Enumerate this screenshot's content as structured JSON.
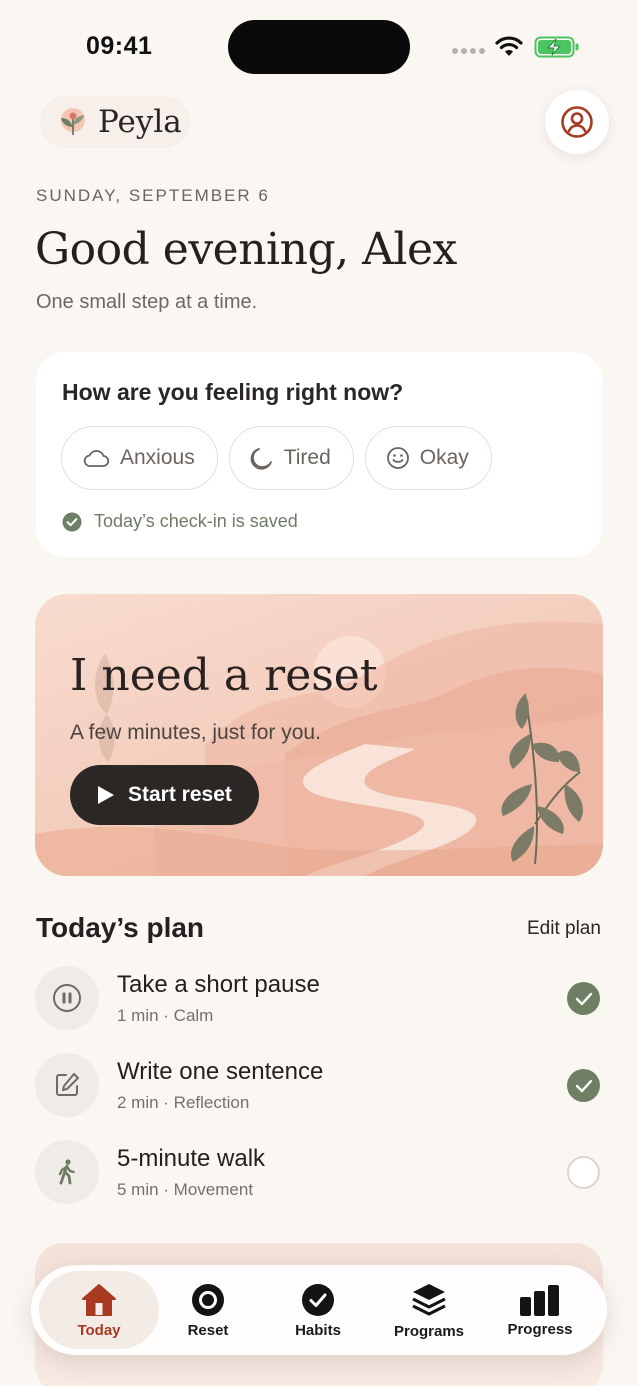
{
  "status_bar": {
    "time": "09:41"
  },
  "header": {
    "app_name": "Peyla",
    "profile_icon": "user-circle-icon"
  },
  "greeting": {
    "date": "SUNDAY, SEPTEMBER 6",
    "title": "Good evening, Alex",
    "subtitle": "One small step at a time."
  },
  "checkin": {
    "question": "How are you feeling right now?",
    "moods": [
      {
        "label": "Anxious",
        "icon": "cloud-icon"
      },
      {
        "label": "Tired",
        "icon": "moon-icon"
      },
      {
        "label": "Okay",
        "icon": "smile-icon"
      }
    ],
    "saved_text": "Today’s check-in is saved"
  },
  "reset_card": {
    "title": "I need a reset",
    "subtitle": "A few minutes, just for you.",
    "button_label": "Start reset"
  },
  "plan": {
    "title": "Today’s plan",
    "edit_label": "Edit plan",
    "items": [
      {
        "name": "Take a short pause",
        "meta": "1 min · Calm",
        "icon": "pause-icon",
        "done": true
      },
      {
        "name": "Write one sentence",
        "meta": "2 min · Reflection",
        "icon": "edit-icon",
        "done": true
      },
      {
        "name": "5-minute walk",
        "meta": "5 min · Movement",
        "icon": "walk-icon",
        "done": false
      }
    ]
  },
  "tabbar": {
    "tabs": [
      {
        "label": "Today",
        "icon": "home-icon",
        "active": true
      },
      {
        "label": "Reset",
        "icon": "ring-icon",
        "active": false
      },
      {
        "label": "Habits",
        "icon": "check-circle-icon",
        "active": false
      },
      {
        "label": "Programs",
        "icon": "layers-icon",
        "active": false
      },
      {
        "label": "Progress",
        "icon": "bar-chart-icon",
        "active": false
      }
    ]
  },
  "colors": {
    "background": "#faf6f2",
    "accent": "#a83a22",
    "success": "#6f7f63",
    "dark_button": "#2b2725"
  }
}
